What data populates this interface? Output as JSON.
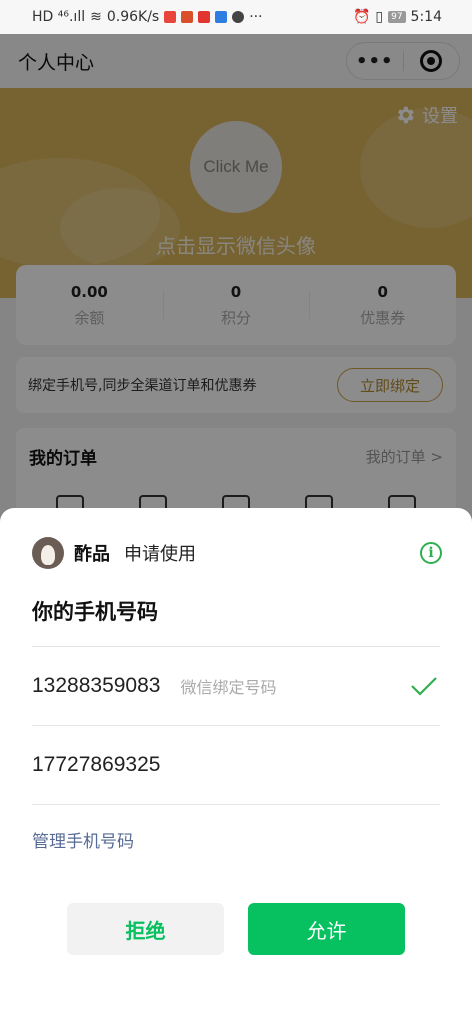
{
  "status_bar": {
    "left_text": "HD ⁴⁶.ıll",
    "speed": "0.96K/s",
    "more": "···",
    "battery": "97",
    "time": "5:14"
  },
  "nav": {
    "title": "个人中心",
    "more_label": "•••"
  },
  "header": {
    "settings_label": "设置",
    "avatar_button": "Click Me",
    "avatar_hint": "点击显示微信头像"
  },
  "stats": [
    {
      "value": "0.00",
      "label": "余额"
    },
    {
      "value": "0",
      "label": "积分"
    },
    {
      "value": "0",
      "label": "优惠券"
    }
  ],
  "bind": {
    "text": "绑定手机号,同步全渠道订单和优惠券",
    "button": "立即绑定"
  },
  "orders": {
    "title": "我的订单",
    "link": "我的订单 >"
  },
  "sheet": {
    "app_name": "酢品",
    "request_text": "申请使用",
    "title": "你的手机号码",
    "phones": [
      {
        "number": "13288359083",
        "tag": "微信绑定号码",
        "selected": true
      },
      {
        "number": "17727869325",
        "tag": "",
        "selected": false
      }
    ],
    "manage_link": "管理手机号码",
    "deny_button": "拒绝",
    "allow_button": "允许"
  },
  "colors": {
    "brand_gold": "#d9b55a",
    "wechat_green": "#07c160",
    "link_blue": "#576b95"
  }
}
